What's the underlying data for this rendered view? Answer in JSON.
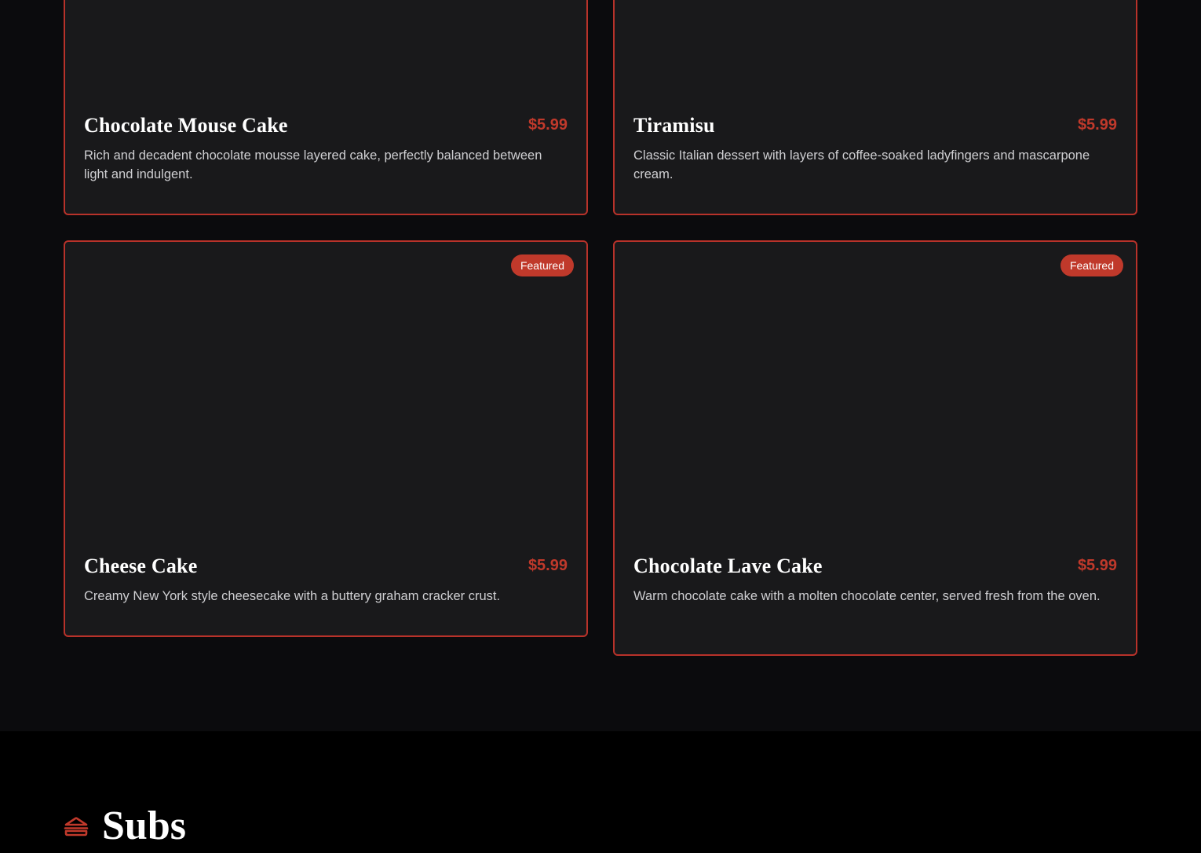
{
  "colors": {
    "accent": "#c0392b",
    "card_border": "#b8322a",
    "card_bg": "#19191b",
    "page_bg": "#0b0b0d",
    "subs_bg": "#000000"
  },
  "menu_items": [
    {
      "name": "Chocolate Mouse Cake",
      "price": "$5.99",
      "description": "Rich and decadent chocolate mousse layered cake, perfectly balanced between light and indulgent.",
      "featured": false
    },
    {
      "name": "Tiramisu",
      "price": "$5.99",
      "description": "Classic Italian dessert with layers of coffee-soaked ladyfingers and mascarpone cream.",
      "featured": false
    },
    {
      "name": "Cheese Cake",
      "price": "$5.99",
      "description": "Creamy New York style cheesecake with a buttery graham cracker crust.",
      "featured": true,
      "badge": "Featured"
    },
    {
      "name": "Chocolate Lave Cake",
      "price": "$5.99",
      "description": "Warm chocolate cake with a molten chocolate center, served fresh from the oven.",
      "featured": true,
      "badge": "Featured"
    }
  ],
  "next_section": {
    "title": "Subs",
    "icon": "sandwich-icon"
  }
}
